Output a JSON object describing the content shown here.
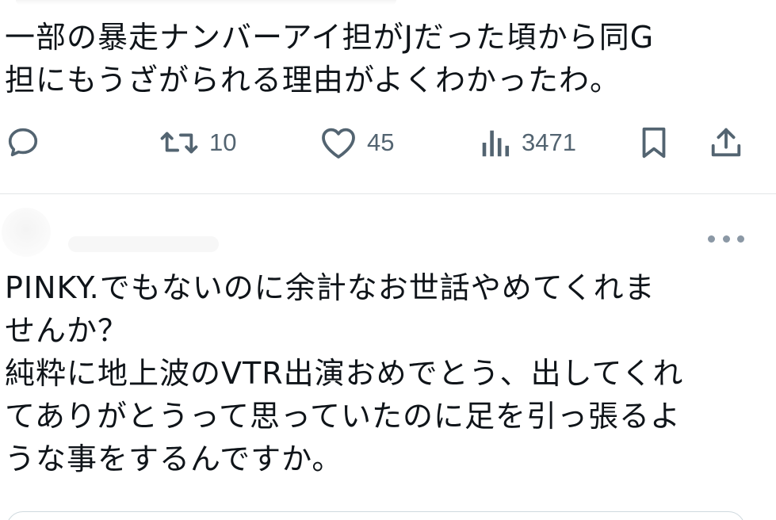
{
  "tweet1": {
    "text": "一部の暴走ナンバーアイ担がJだった頃から同G\n担にもうざがられる理由がよくわかったわ。",
    "actions": {
      "reply": {
        "icon": "reply-icon"
      },
      "retweet": {
        "icon": "retweet-icon",
        "count": "10"
      },
      "like": {
        "icon": "heart-icon",
        "count": "45"
      },
      "views": {
        "icon": "views-chart-icon",
        "count": "3471"
      },
      "bookmark": {
        "icon": "bookmark-icon"
      },
      "share": {
        "icon": "share-icon"
      }
    }
  },
  "tweet2": {
    "more_icon": "more-horizontal-icon",
    "text": "PINKY.でもないのに余計なお世話やめてくれま\nせんか？\n純粋に地上波のVTR出演おめでとう、出してくれ\nてありがとうって思っていたのに足を引っ張るよ\nうな事をするんですか。"
  },
  "colors": {
    "text": "#0f1419",
    "icon": "#536471",
    "divider": "#e3e6e8"
  }
}
